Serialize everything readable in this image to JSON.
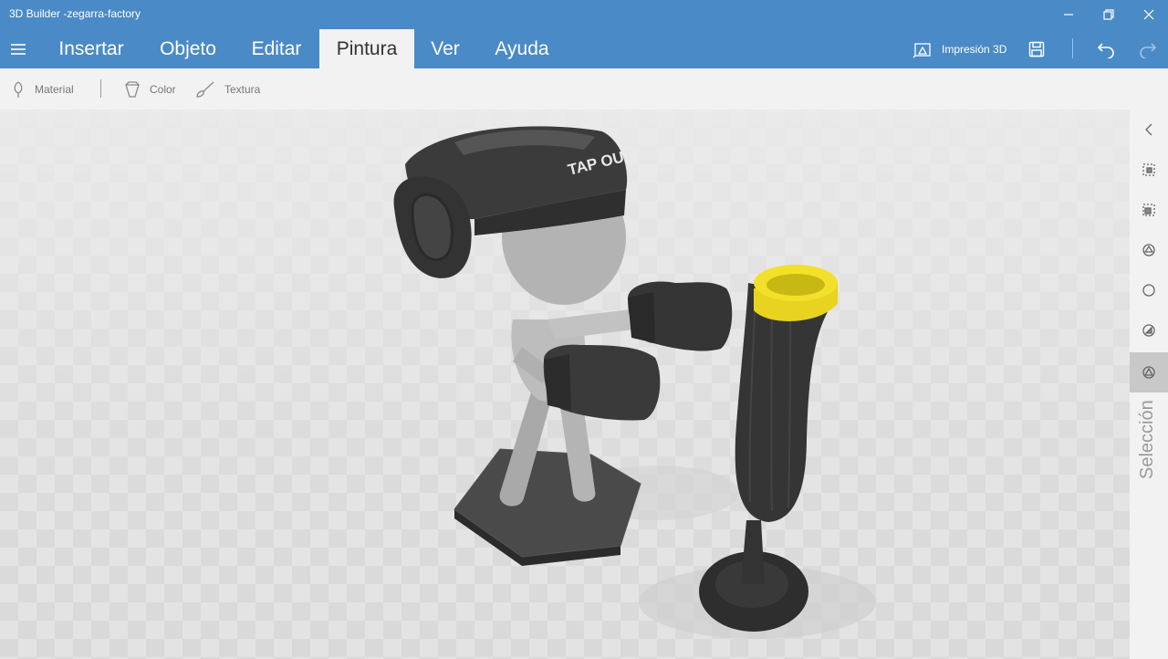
{
  "window": {
    "title": "3D Builder -zegarra-factory"
  },
  "menu": {
    "tabs": [
      {
        "label": "Insertar"
      },
      {
        "label": "Objeto"
      },
      {
        "label": "Editar"
      },
      {
        "label": "Pintura"
      },
      {
        "label": "Ver"
      },
      {
        "label": "Ayuda"
      }
    ],
    "active_tab": "Pintura",
    "print_label": "Impresión 3D"
  },
  "toolbar": {
    "material_label": "Material",
    "color_label": "Color",
    "texture_label": "Textura"
  },
  "scene": {
    "helmet_text": "TAP OUT"
  },
  "side_panel": {
    "label": "Selección"
  },
  "colors": {
    "accent": "#4a8ac7",
    "bag_top": "#f2e02a",
    "model_dark": "#3a3a3a"
  }
}
